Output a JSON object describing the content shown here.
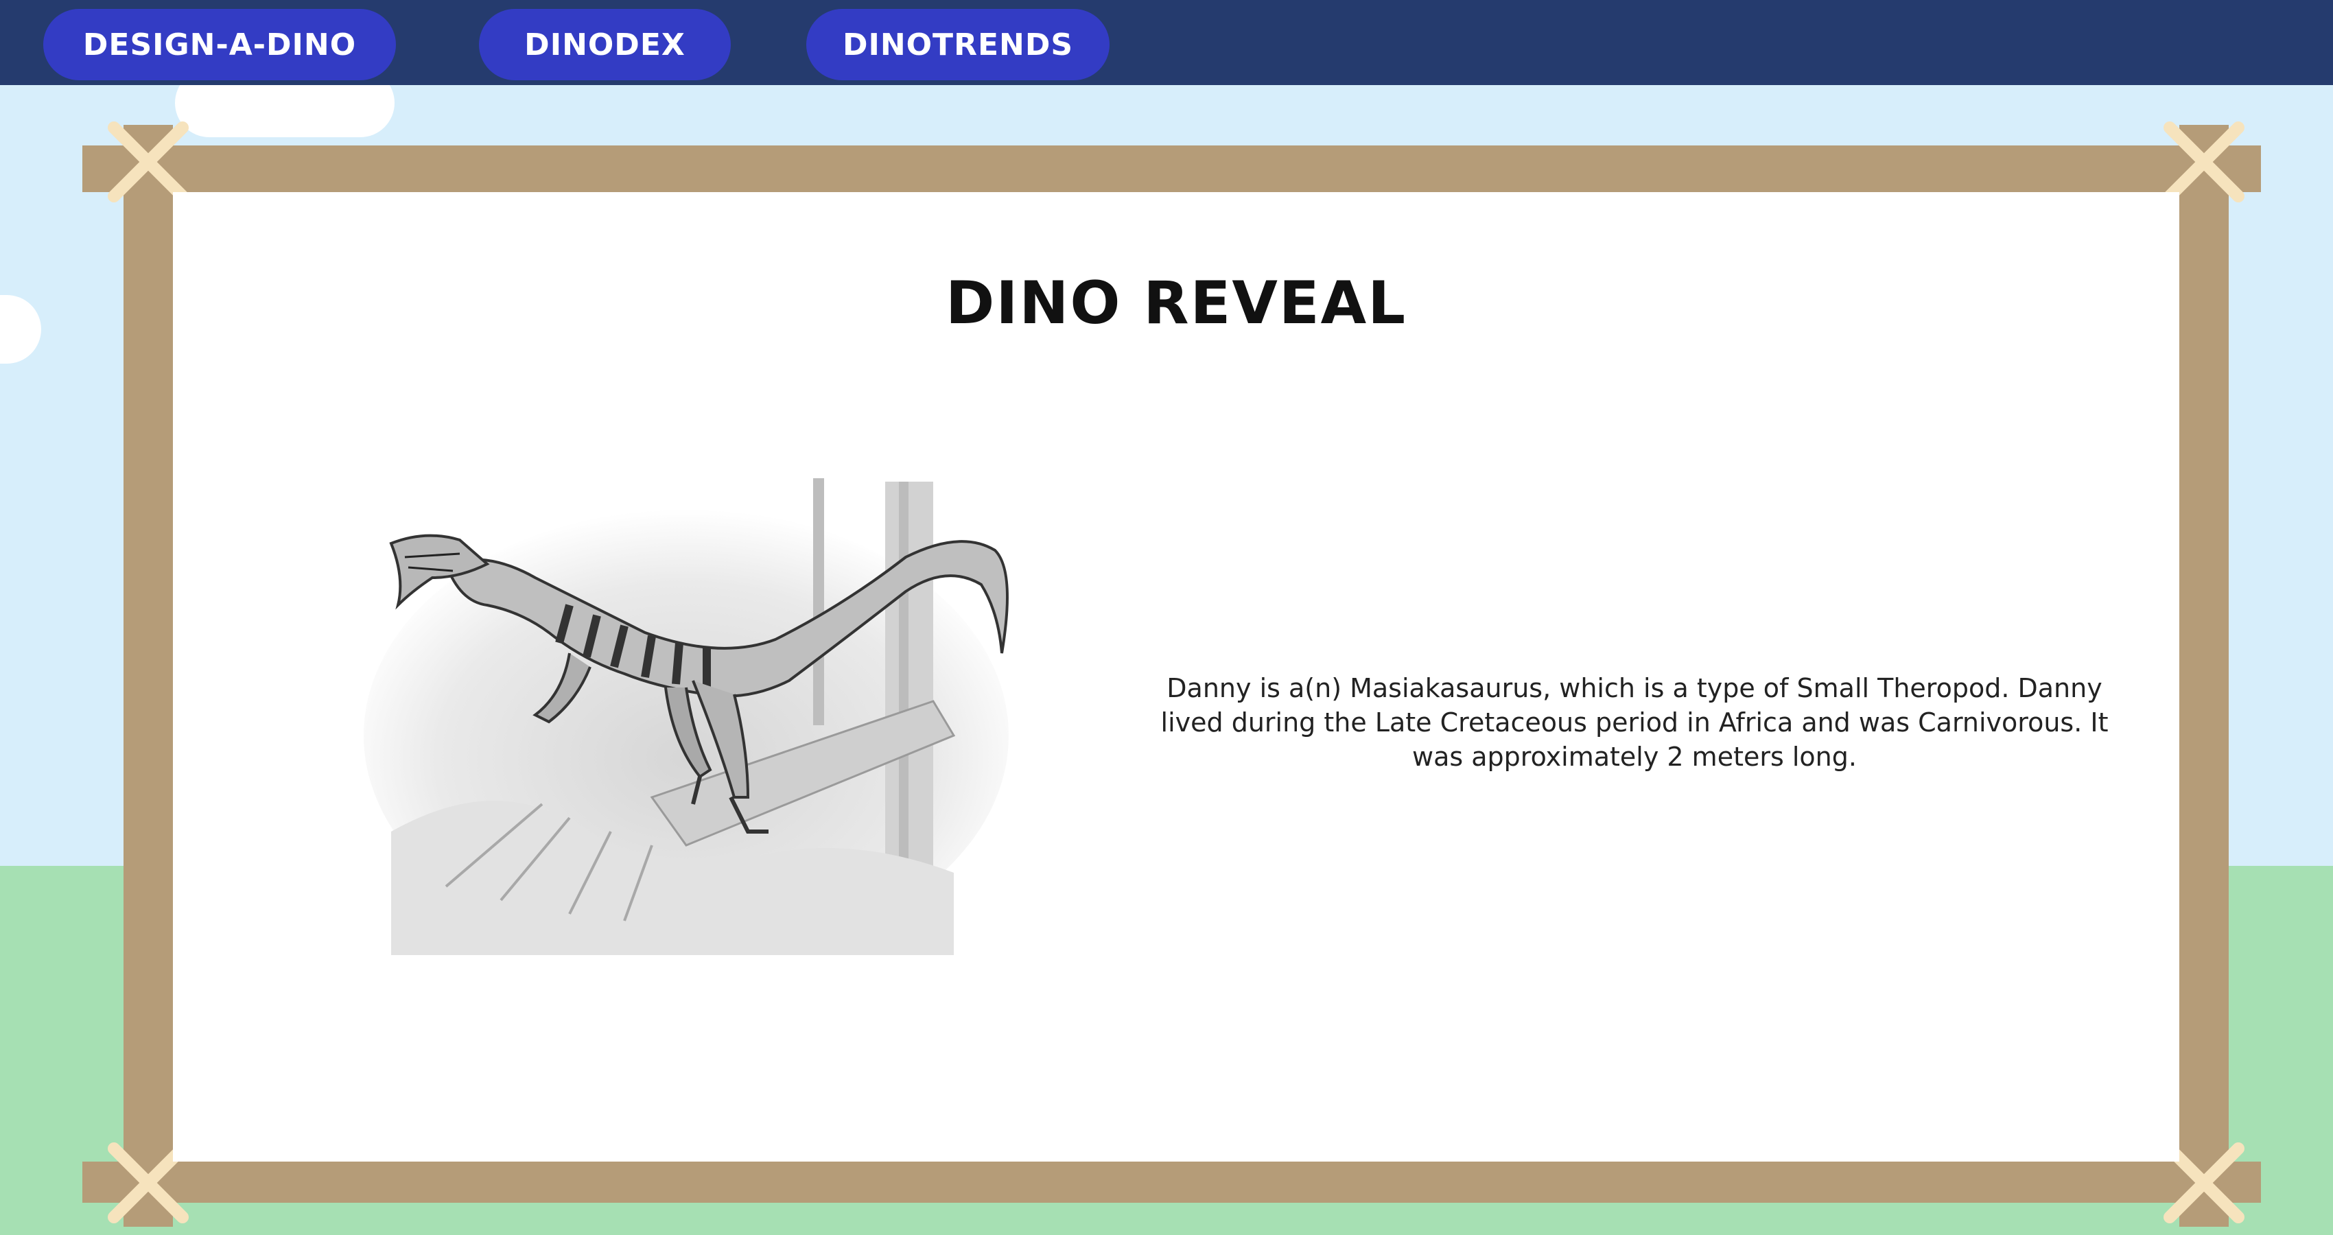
{
  "nav": {
    "items": [
      {
        "label": "Design-A-Dino"
      },
      {
        "label": "Dinodex"
      },
      {
        "label": "DinoTrends"
      }
    ]
  },
  "reveal": {
    "title": "Dino Reveal",
    "description": "Danny is a(n) Masiakasaurus, which is a type of Small Theropod. Danny lived during the Late Cretaceous period in Africa and was Carnivorous. It was approximately 2 meters long."
  },
  "colors": {
    "sky": "#d7eefb",
    "grass": "#a6e0b3",
    "navbar": "#253b6e",
    "nav_button": "#333cc4",
    "frame_wood": "#b59c78",
    "tape": "#f6e3bd"
  },
  "icons": {
    "illustration": "masiakasaurus-illustration"
  }
}
